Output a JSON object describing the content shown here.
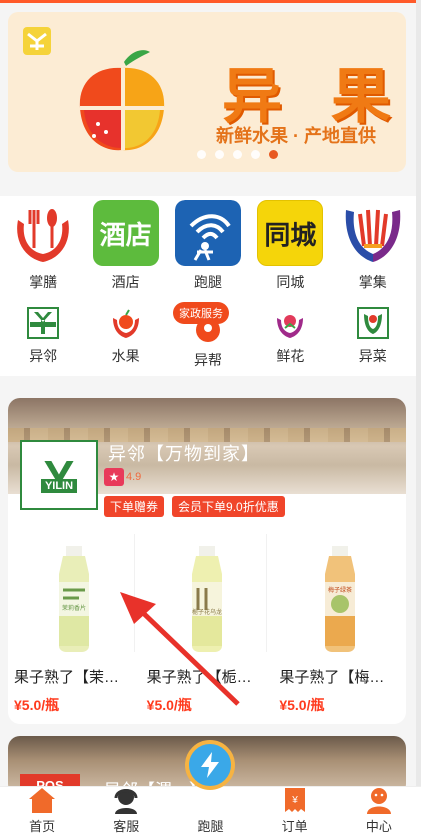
{
  "banner": {
    "title": "异 果",
    "subtitle": "新鲜水果 · 产地直供",
    "dots": 5,
    "active_dot": 5
  },
  "categories_row1": [
    {
      "label": "掌膳",
      "icon": "hands-fork-spoon-icon"
    },
    {
      "label": "酒店",
      "icon_text": "酒店",
      "icon": "hotel-icon"
    },
    {
      "label": "跑腿",
      "icon": "runner-wifi-icon"
    },
    {
      "label": "同城",
      "icon_text": "同城",
      "icon": "same-city-icon"
    },
    {
      "label": "掌集",
      "icon": "hands-gift-icon"
    }
  ],
  "categories_row2": [
    {
      "label": "异邻",
      "icon": "yilin-logo-icon"
    },
    {
      "label": "水果",
      "icon": "fruit-hands-icon"
    },
    {
      "label": "异帮",
      "icon": "helper-icon",
      "badge": "家政服务"
    },
    {
      "label": "鲜花",
      "icon": "flower-icon"
    },
    {
      "label": "异菜",
      "icon": "vegetable-icon"
    }
  ],
  "shop": {
    "name": "异邻【万物到家】",
    "logo_text": "YILIN",
    "rating": "4.9",
    "coupons": [
      "下单赠券",
      "会员下单9.0折优惠"
    ],
    "products": [
      {
        "name": "果子熟了【茉…",
        "price": "¥5.0/瓶",
        "label": "茉莉香片"
      },
      {
        "name": "果子熟了【栀…",
        "price": "¥5.0/瓶",
        "label": "栀子花乌龙"
      },
      {
        "name": "果子熟了【梅…",
        "price": "¥5.0/瓶",
        "label": "梅子绿茶"
      }
    ]
  },
  "shop2": {
    "name": "异邻【渭…】",
    "logo_text": "POS"
  },
  "tabbar": [
    {
      "label": "首页",
      "icon": "home-icon"
    },
    {
      "label": "客服",
      "icon": "headset-icon"
    },
    {
      "label": "跑腿",
      "icon": "lightning-icon"
    },
    {
      "label": "订单",
      "icon": "order-icon"
    },
    {
      "label": "中心",
      "icon": "user-center-icon"
    }
  ],
  "colors": {
    "accent": "#ff5a2a",
    "price": "#ff3b1e",
    "banner_bg": "#fcecd4"
  }
}
